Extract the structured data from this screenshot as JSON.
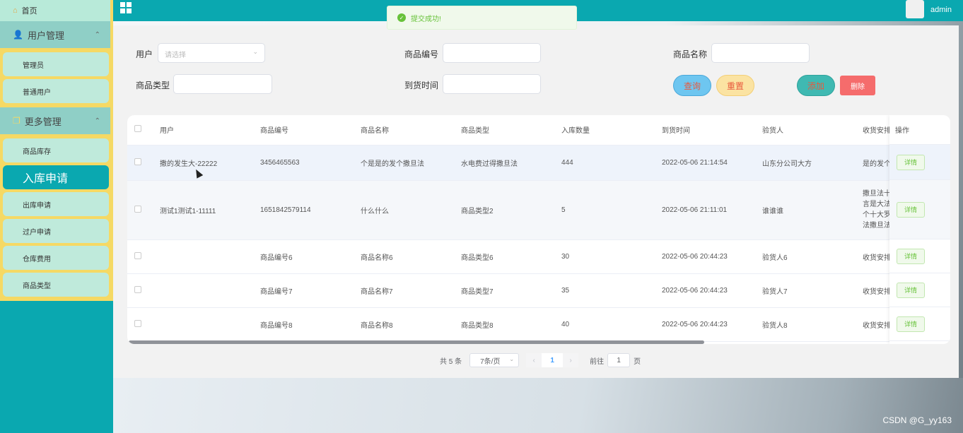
{
  "header": {
    "title": "",
    "username": "admin"
  },
  "toast": {
    "message": "提交成功!"
  },
  "sidebar": {
    "home": "首页",
    "groups": [
      {
        "label": "用户管理",
        "items": [
          "管理员",
          "普通用户"
        ]
      },
      {
        "label": "更多管理",
        "items": [
          "商品库存",
          "入库申请",
          "出库申请",
          "过户申请",
          "仓库费用",
          "商品类型"
        ]
      }
    ]
  },
  "search": {
    "user_label": "用户",
    "user_placeholder": "请选择",
    "code_label": "商品编号",
    "name_label": "商品名称",
    "type_label": "商品类型",
    "arrival_label": "到货时间",
    "query_btn": "查询",
    "reset_btn": "重置",
    "add_btn": "添加",
    "delete_btn": "删除"
  },
  "table": {
    "columns": [
      "用户",
      "商品编号",
      "商品名称",
      "商品类型",
      "入库数量",
      "到货时间",
      "验货人",
      "收货安排"
    ],
    "op_column": "操作",
    "detail_btn": "详情",
    "rows": [
      {
        "user": "撒的发生大-22222",
        "code": "3456465563",
        "name": "个是是的发个撒旦法",
        "type": "水电费过得撒旦法",
        "qty": "444",
        "time": "2022-05-06 21:14:54",
        "inspector": "山东分公司大方",
        "arrange": "是的发个"
      },
      {
        "user": "测试1测试1-11111",
        "code": "1651842579114",
        "name": "什么什么",
        "type": "商品类型2",
        "qty": "5",
        "time": "2022-05-06 21:11:01",
        "inspector": "谁谁谁",
        "arrange": "撒旦法十\n言是大法\n个十大罗\n法撒旦法"
      },
      {
        "user": "",
        "code": "商品编号6",
        "name": "商品名称6",
        "type": "商品类型6",
        "qty": "30",
        "time": "2022-05-06 20:44:23",
        "inspector": "验货人6",
        "arrange": "收货安排"
      },
      {
        "user": "",
        "code": "商品编号7",
        "name": "商品名称7",
        "type": "商品类型7",
        "qty": "35",
        "time": "2022-05-06 20:44:23",
        "inspector": "验货人7",
        "arrange": "收货安排"
      },
      {
        "user": "",
        "code": "商品编号8",
        "name": "商品名称8",
        "type": "商品类型8",
        "qty": "40",
        "time": "2022-05-06 20:44:23",
        "inspector": "验货人8",
        "arrange": "收货安排"
      }
    ]
  },
  "pagination": {
    "total": "共 5 条",
    "page_size": "7条/页",
    "current": "1",
    "goto_prefix": "前往",
    "goto_value": "1",
    "goto_suffix": "页"
  },
  "watermark": "CSDN @G_yy163"
}
